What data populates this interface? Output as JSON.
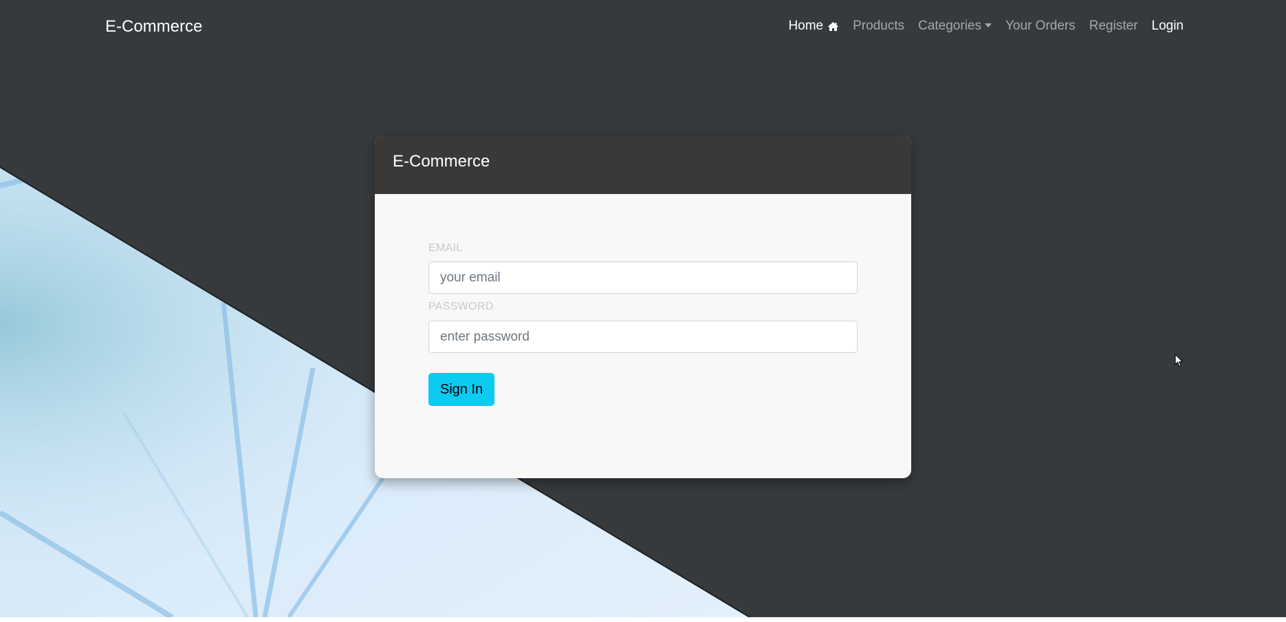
{
  "navbar": {
    "brand": "E-Commerce",
    "items": [
      {
        "label": "Home",
        "active": true,
        "icon": "home-icon"
      },
      {
        "label": "Products",
        "active": false
      },
      {
        "label": "Categories",
        "active": false,
        "dropdown": true
      },
      {
        "label": "Your Orders",
        "active": false
      },
      {
        "label": "Register",
        "active": false
      },
      {
        "label": "Login",
        "active": true
      }
    ]
  },
  "login_card": {
    "title": "E-Commerce",
    "email_label": "EMAIL",
    "email_placeholder": "your email",
    "email_value": "",
    "password_label": "PASSWORD",
    "password_placeholder": "enter password",
    "password_value": "",
    "submit_label": "Sign In"
  },
  "colors": {
    "background": "#373a3d",
    "card_header": "#3b3937",
    "card_body": "#f8f8f8",
    "primary_button": "#0dcaf0",
    "hero_art": "#d6e9f8"
  }
}
